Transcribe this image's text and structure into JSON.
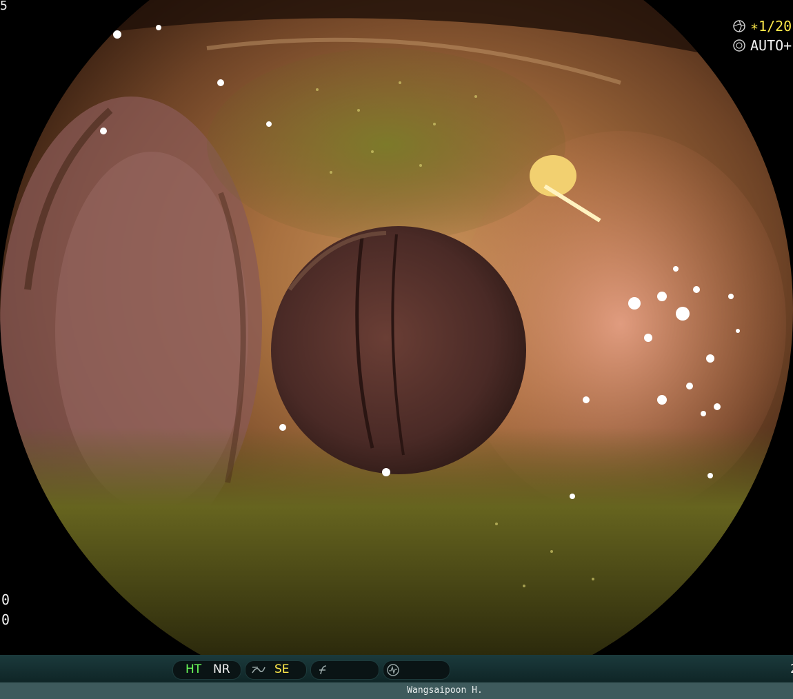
{
  "overlay": {
    "shutter_value": "∗1/20",
    "auto_value": "AUTO+",
    "left_top_fragment": "5",
    "left_bottom_1": "0",
    "left_bottom_2": "0",
    "right_bottom_fragment": "2"
  },
  "status_bar": {
    "ht_label": "HT",
    "nr_label": "NR",
    "se_label": "SE",
    "icons": [
      "contrast-icon",
      "freeze-icon",
      "waveform-icon"
    ]
  },
  "footer": {
    "operator_name": "Wangsaipoon H."
  },
  "colors": {
    "osd_yellow": "#ffe94a",
    "osd_green": "#6cff5a",
    "bar_teal": "#1b3a3c"
  }
}
